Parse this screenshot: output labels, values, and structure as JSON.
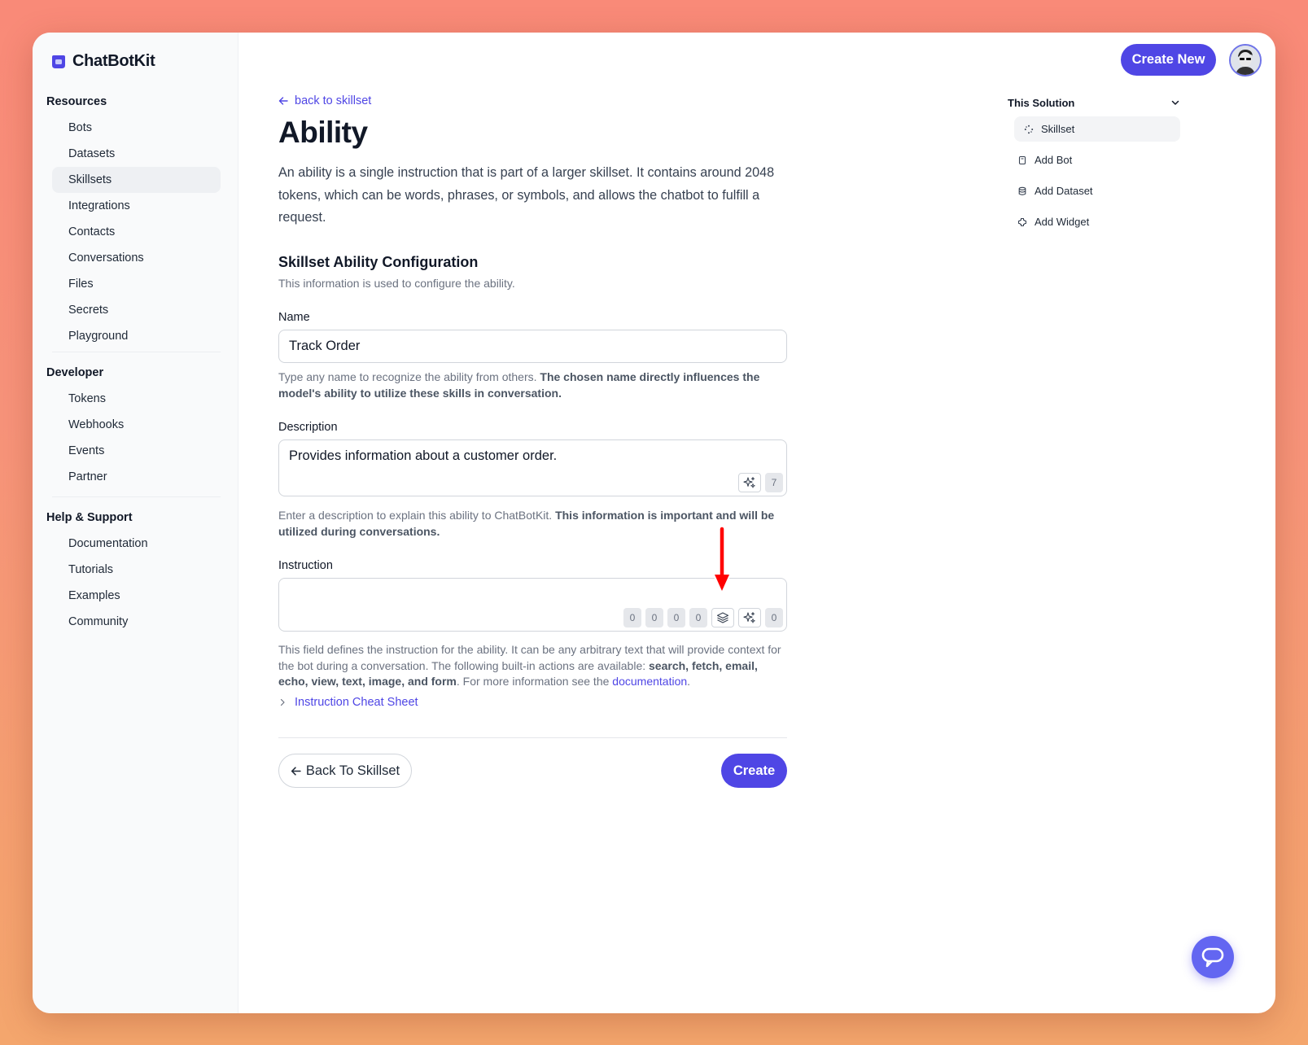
{
  "app": {
    "name": "ChatBotKit",
    "brand_color": "#4f46e5"
  },
  "sidebar": {
    "groups": [
      {
        "heading": "Resources",
        "items": [
          "Bots",
          "Datasets",
          "Skillsets",
          "Integrations",
          "Contacts",
          "Conversations",
          "Files",
          "Secrets",
          "Playground"
        ]
      },
      {
        "heading": "Developer",
        "items": [
          "Tokens",
          "Webhooks",
          "Events",
          "Partner"
        ]
      },
      {
        "heading": "Help & Support",
        "items": [
          "Documentation",
          "Tutorials",
          "Examples",
          "Community"
        ]
      }
    ],
    "active_item": "Skillsets"
  },
  "header": {
    "create_label": "Create New"
  },
  "main": {
    "back_link": "back to skillset",
    "title": "Ability",
    "intro": "An ability is a single instruction that is part of a larger skillset. It contains around 2048 tokens, which can be words, phrases, or symbols, and allows the chatbot to fulfill a request.",
    "section_title": "Skillset Ability Configuration",
    "section_sub": "This information is used to configure the ability.",
    "name_field": {
      "label": "Name",
      "value": "Track Order",
      "help_plain": "Type any name to recognize the ability from others. ",
      "help_bold": "The chosen name directly influences the model's ability to utilize these skills in conversation."
    },
    "description_field": {
      "label": "Description",
      "value": "Provides information about a customer order.",
      "count": "7",
      "help_plain": "Enter a description to explain this ability to ChatBotKit. ",
      "help_bold": "This information is important and will be utilized during conversations."
    },
    "instruction_field": {
      "label": "Instruction",
      "value": "",
      "chips": [
        "0",
        "0",
        "0",
        "0"
      ],
      "count": "0",
      "help_part1": "This field defines the instruction for the ability. It can be any arbitrary text that will provide context for the bot during a conversation. The following built-in actions are available: ",
      "help_bold": "search, fetch, email, echo, view, text, image, and form",
      "help_part2": ". For more information see the ",
      "help_link": "documentation",
      "help_end": "."
    },
    "cheat_sheet": "Instruction Cheat Sheet",
    "back_button": "Back To Skillset",
    "create_button": "Create"
  },
  "right_panel": {
    "heading": "This Solution",
    "items": [
      {
        "label": "Skillset",
        "icon": "skillset-icon",
        "active": true
      },
      {
        "label": "Add Bot",
        "icon": "bot-icon",
        "active": false
      },
      {
        "label": "Add Dataset",
        "icon": "dataset-icon",
        "active": false
      },
      {
        "label": "Add Widget",
        "icon": "widget-icon",
        "active": false
      }
    ]
  },
  "annotation": {
    "arrow_color": "#ff0000"
  }
}
